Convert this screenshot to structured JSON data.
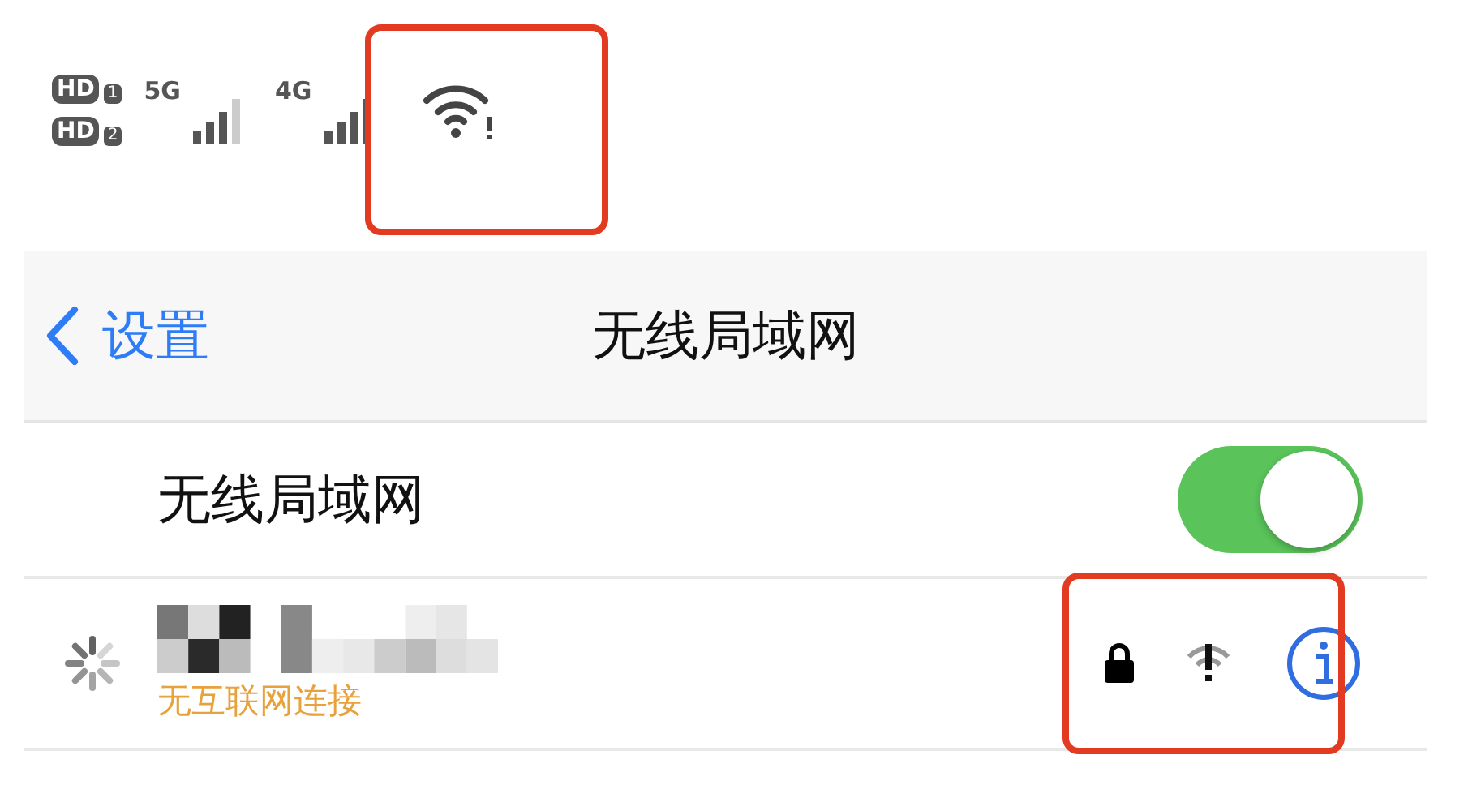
{
  "status_bar": {
    "sims": [
      {
        "badge": "HD",
        "slot": "1"
      },
      {
        "badge": "HD",
        "slot": "2"
      }
    ],
    "networks": [
      "5G",
      "4G"
    ],
    "wifi_warning": true
  },
  "nav": {
    "back": "设置",
    "title": "无线局域网"
  },
  "wifi_row": {
    "label": "无线局域网",
    "on": true
  },
  "network": {
    "connecting": true,
    "status": "无互联网连接",
    "secured": true,
    "no_internet": true
  }
}
